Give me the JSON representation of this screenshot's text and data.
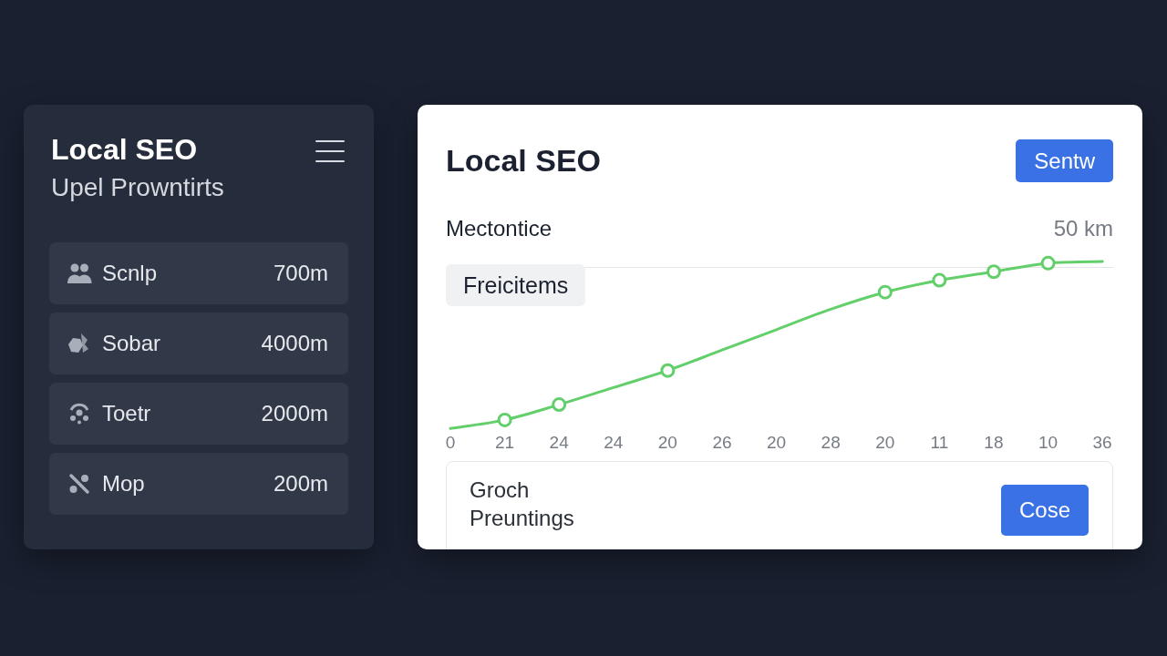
{
  "sidebar": {
    "title": "Local SEO",
    "subtitle": "Upel Prowntirts",
    "items": [
      {
        "label": "Scnlp",
        "value": "700m"
      },
      {
        "label": "Sobar",
        "value": "4000m"
      },
      {
        "label": "Toetr",
        "value": "2000m"
      },
      {
        "label": "Mop",
        "value": "200m"
      }
    ]
  },
  "panel": {
    "title": "Local SEO",
    "button": "Sentw",
    "metric": {
      "label": "Mectontice",
      "value": "50 km"
    },
    "tag": "Freicitems",
    "chart": {
      "x_labels": [
        "0",
        "21",
        "24",
        "24",
        "20",
        "26",
        "20",
        "28",
        "20",
        "11",
        "18",
        "10",
        "36"
      ]
    },
    "footer": {
      "text": "Groch Preuntings",
      "button": "Cose"
    }
  }
}
